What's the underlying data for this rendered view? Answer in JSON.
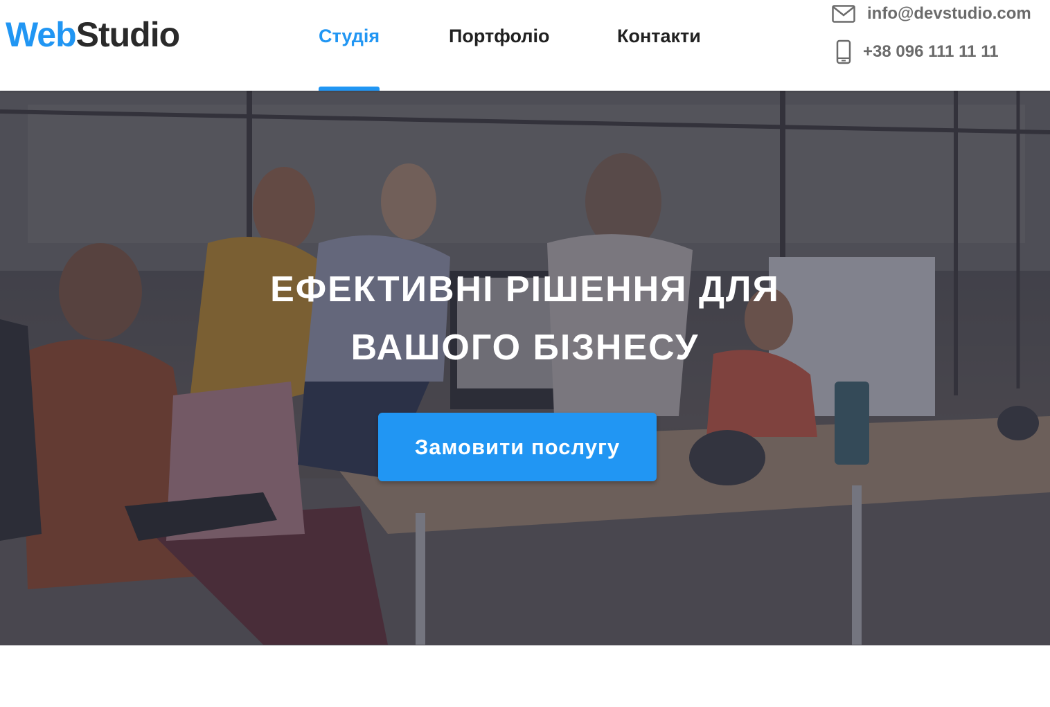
{
  "header": {
    "logo": {
      "accent": "Web",
      "rest": "Studio"
    },
    "nav": [
      {
        "label": "Студія",
        "active": true
      },
      {
        "label": "Портфоліо",
        "active": false
      },
      {
        "label": "Контакти",
        "active": false
      }
    ],
    "contacts": {
      "email": "info@devstudio.com",
      "phone": "+38 096 111 11 11",
      "email_icon": "envelope-icon",
      "phone_icon": "smartphone-icon"
    }
  },
  "hero": {
    "title_line1": "ЕФЕКТИВНІ РІШЕННЯ ДЛЯ",
    "title_line2": "ВАШОГО БІЗНЕСУ",
    "cta_label": "Замовити послугу"
  },
  "colors": {
    "accent": "#2196f3",
    "text_dark": "#212121",
    "text_muted": "#6b6b6b",
    "overlay": "#2e2f42"
  }
}
